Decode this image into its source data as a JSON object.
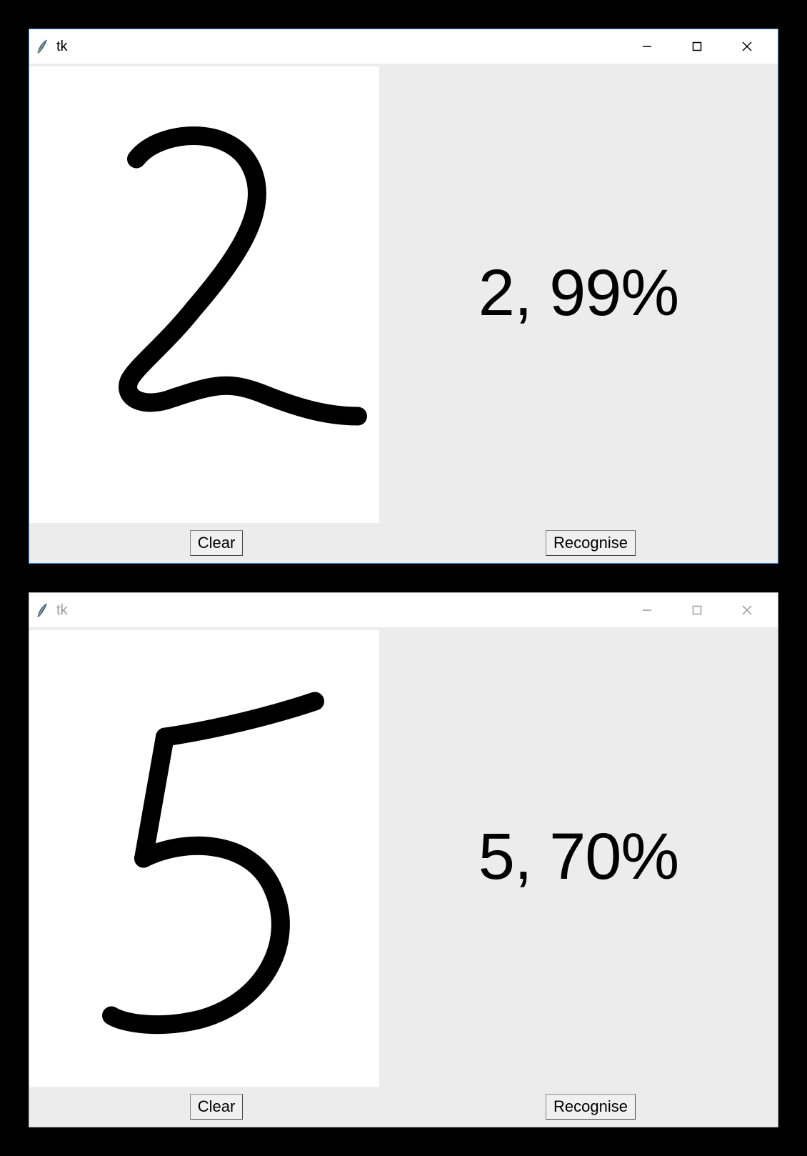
{
  "windows": [
    {
      "active": true,
      "title": "tk",
      "drawn_digit": "2",
      "result": "2, 99%",
      "buttons": {
        "clear": "Clear",
        "recognise": "Recognise"
      }
    },
    {
      "active": false,
      "title": "tk",
      "drawn_digit": "5",
      "result": "5, 70%",
      "buttons": {
        "clear": "Clear",
        "recognise": "Recognise"
      }
    }
  ]
}
